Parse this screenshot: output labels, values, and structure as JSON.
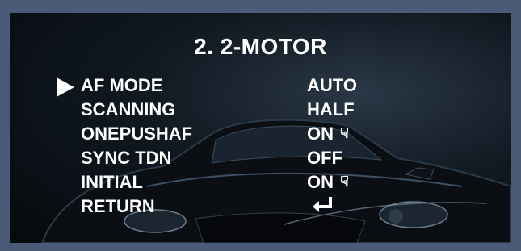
{
  "menu": {
    "title": "2. 2-MOTOR",
    "items": [
      {
        "label": "AF MODE",
        "value": "AUTO"
      },
      {
        "label": "SCANNING",
        "value": "HALF"
      },
      {
        "label": "ONEPUSHAF",
        "value": "ON",
        "icon": "hand-pointer-icon"
      },
      {
        "label": "SYNC TDN",
        "value": "OFF"
      },
      {
        "label": "INITIAL",
        "value": "ON",
        "icon": "hand-pointer-icon"
      },
      {
        "label": "RETURN",
        "icon": "enter-return-icon"
      }
    ],
    "selected_index": 0
  },
  "colors": {
    "frame": "#4a5b78",
    "text": "#ffffff"
  }
}
